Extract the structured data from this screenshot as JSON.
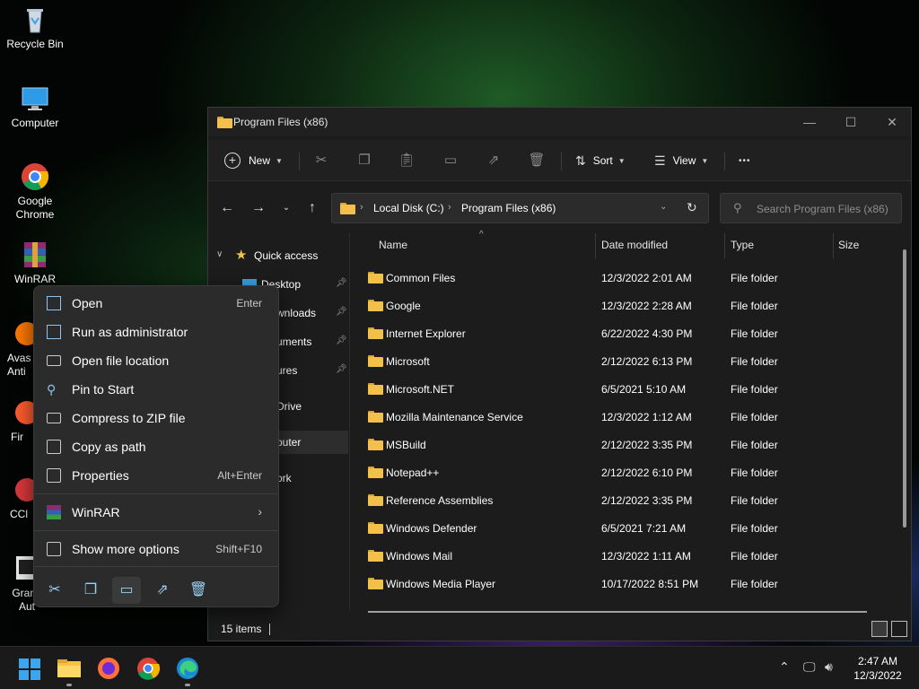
{
  "desktop": {
    "icons": [
      {
        "label": "Recycle Bin"
      },
      {
        "label": "Computer"
      },
      {
        "label": "Google Chrome"
      },
      {
        "label": "WinRAR"
      },
      {
        "label": "Avas Anti"
      },
      {
        "label": "Fir"
      },
      {
        "label": "CCl"
      },
      {
        "label": "Grand Aut"
      }
    ]
  },
  "window": {
    "title": "Program Files (x86)",
    "minimize": "—",
    "maximize": "☐",
    "close": "✕"
  },
  "toolbar": {
    "new_label": "New",
    "sort_label": "Sort",
    "view_label": "View",
    "more_label": "•••"
  },
  "address": {
    "crumbs": [
      "Local Disk (C:)",
      "Program Files (x86)"
    ],
    "search_placeholder": "Search Program Files (x86)"
  },
  "navpane": {
    "quick_access": "Quick access",
    "items": [
      "Desktop",
      "wnloads",
      "uments",
      "ures",
      "Drive",
      "puter",
      "ork"
    ]
  },
  "columns": {
    "name": "Name",
    "date": "Date modified",
    "type": "Type",
    "size": "Size"
  },
  "files": [
    {
      "name": "Common Files",
      "date": "12/3/2022 2:01 AM",
      "type": "File folder"
    },
    {
      "name": "Google",
      "date": "12/3/2022 2:28 AM",
      "type": "File folder"
    },
    {
      "name": "Internet Explorer",
      "date": "6/22/2022 4:30 PM",
      "type": "File folder"
    },
    {
      "name": "Microsoft",
      "date": "2/12/2022 6:13 PM",
      "type": "File folder"
    },
    {
      "name": "Microsoft.NET",
      "date": "6/5/2021 5:10 AM",
      "type": "File folder"
    },
    {
      "name": "Mozilla Maintenance Service",
      "date": "12/3/2022 1:12 AM",
      "type": "File folder"
    },
    {
      "name": "MSBuild",
      "date": "2/12/2022 3:35 PM",
      "type": "File folder"
    },
    {
      "name": "Notepad++",
      "date": "2/12/2022 6:10 PM",
      "type": "File folder"
    },
    {
      "name": "Reference Assemblies",
      "date": "2/12/2022 3:35 PM",
      "type": "File folder"
    },
    {
      "name": "Windows Defender",
      "date": "6/5/2021 7:21 AM",
      "type": "File folder"
    },
    {
      "name": "Windows Mail",
      "date": "12/3/2022 1:11 AM",
      "type": "File folder"
    },
    {
      "name": "Windows Media Player",
      "date": "10/17/2022 8:51 PM",
      "type": "File folder"
    }
  ],
  "status": {
    "count": "15 items"
  },
  "context_menu": {
    "items": [
      {
        "label": "Open",
        "shortcut": "Enter"
      },
      {
        "label": "Run as administrator",
        "shortcut": ""
      },
      {
        "label": "Open file location",
        "shortcut": ""
      },
      {
        "label": "Pin to Start",
        "shortcut": ""
      },
      {
        "label": "Compress to ZIP file",
        "shortcut": ""
      },
      {
        "label": "Copy as path",
        "shortcut": ""
      },
      {
        "label": "Properties",
        "shortcut": "Alt+Enter"
      },
      {
        "label": "WinRAR",
        "shortcut": ""
      },
      {
        "label": "Show more options",
        "shortcut": "Shift+F10"
      }
    ]
  },
  "taskbar": {
    "time": "2:47 AM",
    "date": "12/3/2022"
  },
  "colors": {
    "accent": "#0078d4",
    "folder": "#f3c14a"
  }
}
